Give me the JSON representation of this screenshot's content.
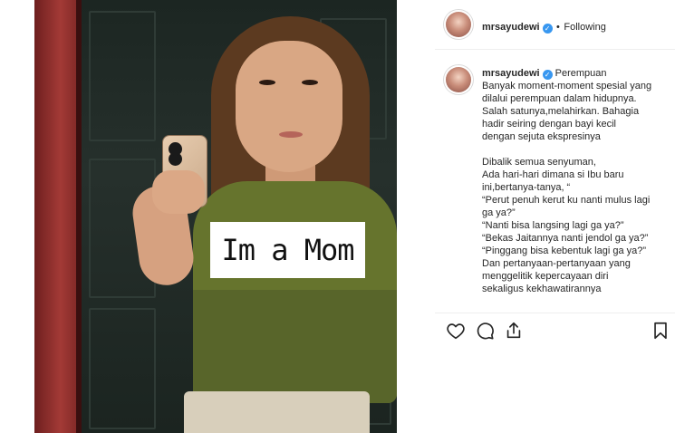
{
  "photo": {
    "sticker_text": "Im a Mom"
  },
  "header": {
    "username": "mrsayudewi",
    "separator": "•",
    "follow_status": "Following",
    "verified_icon": "verified-badge-icon"
  },
  "caption": {
    "username": "mrsayudewi",
    "lines": [
      "Perempuan",
      "Banyak moment-moment spesial yang",
      "dilalui perempuan dalam hidupnya.",
      "Salah satunya,melahirkan. Bahagia",
      "hadir seiring dengan bayi kecil",
      "dengan sejuta ekspresinya",
      "Dibalik semua senyuman,",
      "Ada hari-hari dimana si Ibu baru",
      "ini,bertanya-tanya, “",
      "“Perut penuh kerut ku nanti mulus lagi",
      "ga ya?”",
      "“Nanti bisa langsing lagi ga ya?”",
      "“Bekas Jaitannya nanti jendol ga ya?”",
      "“Pinggang bisa kebentuk lagi ga ya?”",
      "Dan pertanyaan-pertanyaan yang",
      "menggelitik kepercayaan diri",
      "sekaligus kekhawatirannya"
    ]
  },
  "actions": {
    "like": "heart-icon",
    "comment": "comment-icon",
    "share": "share-icon",
    "save": "bookmark-icon"
  },
  "colors": {
    "verified": "#3897f0",
    "text": "#262626",
    "divider": "#efefef"
  }
}
